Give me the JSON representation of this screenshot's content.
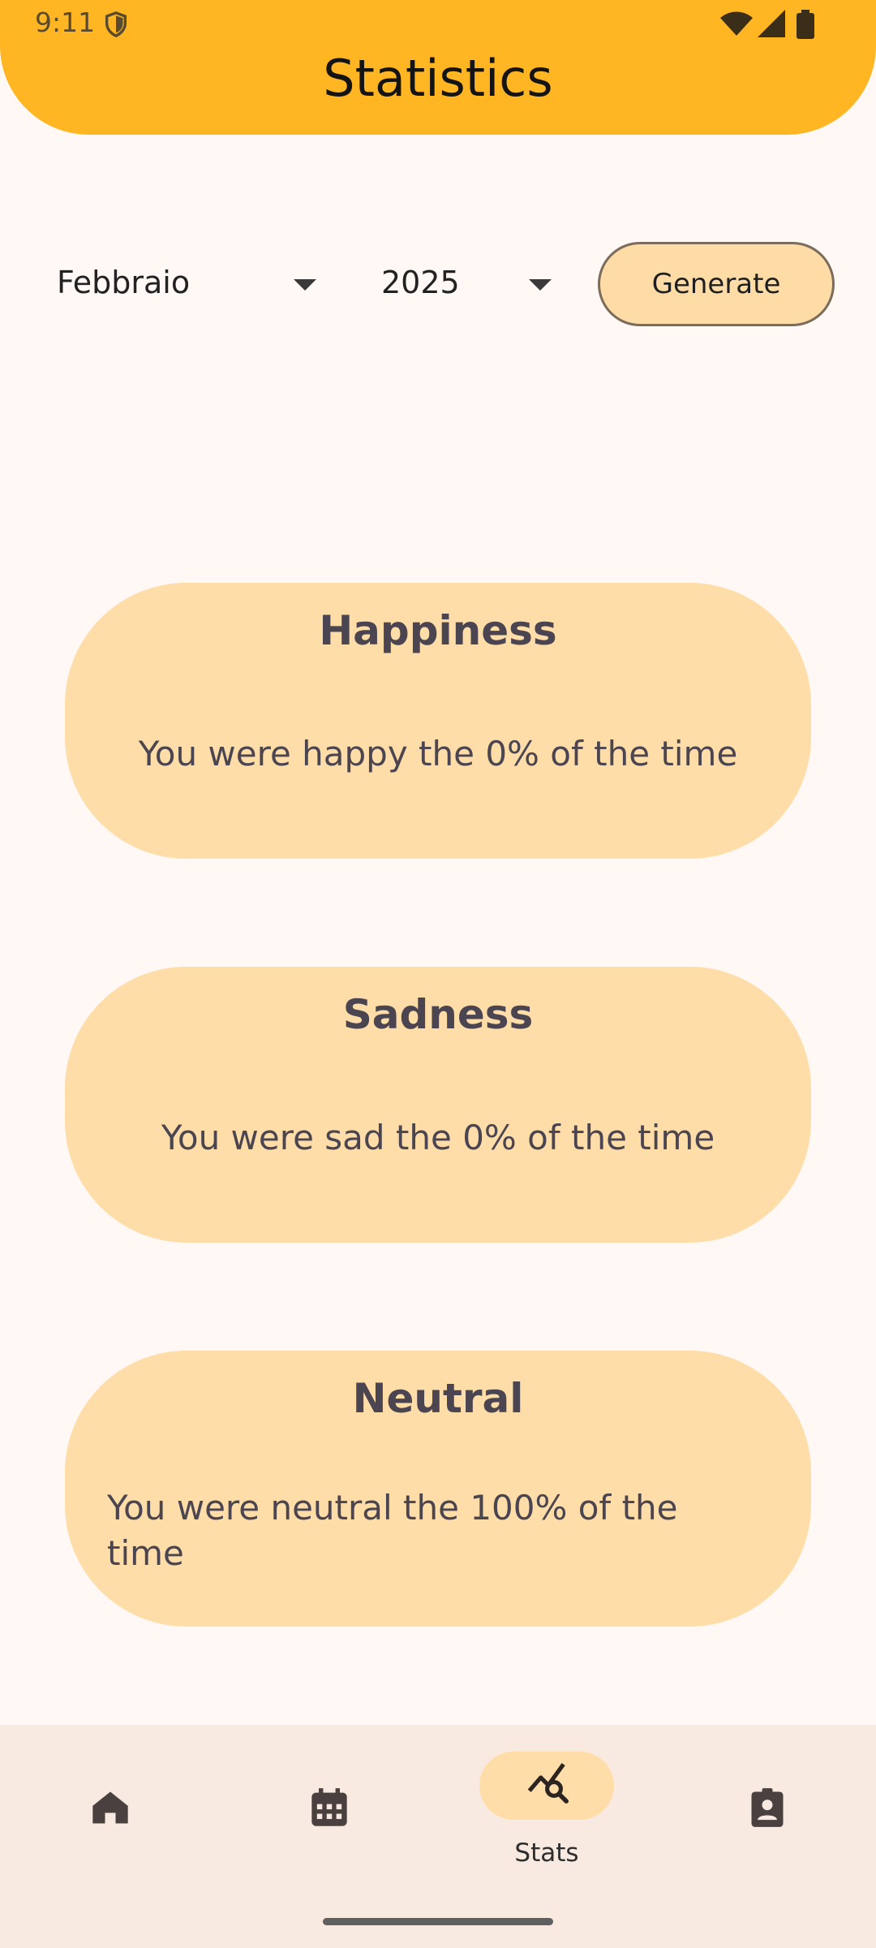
{
  "status_bar": {
    "time": "9:11"
  },
  "header": {
    "title": "Statistics"
  },
  "controls": {
    "month": "Febbraio",
    "year": "2025",
    "generate_label": "Generate"
  },
  "cards": [
    {
      "title": "Happiness",
      "text": "You were happy the 0% of the time"
    },
    {
      "title": "Sadness",
      "text": "You were sad the 0% of the time"
    },
    {
      "title": "Neutral",
      "text": "You were neutral the 100% of the time"
    }
  ],
  "bottom_nav": {
    "items": [
      {
        "icon": "home-icon",
        "label": ""
      },
      {
        "icon": "calendar-icon",
        "label": ""
      },
      {
        "icon": "stats-icon",
        "label": "Stats",
        "selected": true
      },
      {
        "icon": "profile-icon",
        "label": ""
      }
    ]
  },
  "colors": {
    "header": "#FFB622",
    "card": "#FFDDA8",
    "background": "#FFF8F4",
    "nav_background": "#F8EAE0"
  }
}
